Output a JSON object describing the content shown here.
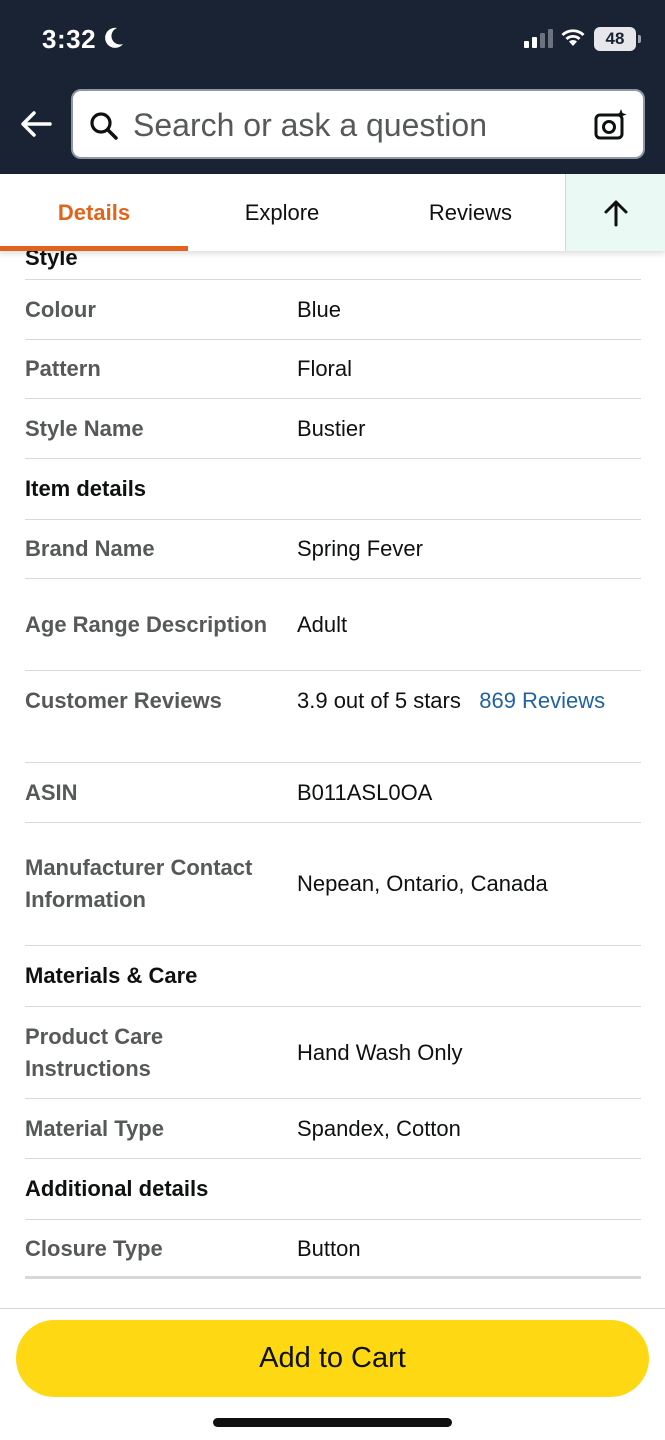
{
  "status_bar": {
    "time": "3:32",
    "battery": "48"
  },
  "search": {
    "placeholder": "Search or ask a question"
  },
  "tabs": [
    {
      "label": "Details",
      "active": true
    },
    {
      "label": "Explore",
      "active": false
    },
    {
      "label": "Reviews",
      "active": false
    }
  ],
  "sections": {
    "style": {
      "title": "Style",
      "rows": [
        {
          "label": "Colour",
          "value": "Blue"
        },
        {
          "label": "Pattern",
          "value": "Floral"
        },
        {
          "label": "Style Name",
          "value": "Bustier"
        }
      ]
    },
    "item_details": {
      "title": "Item details",
      "rows": [
        {
          "label": "Brand Name",
          "value": "Spring Fever"
        },
        {
          "label": "Age Range Description",
          "value": "Adult"
        },
        {
          "label": "Customer Reviews",
          "value": "3.9 out of 5 stars",
          "link": "869 Reviews"
        },
        {
          "label": "ASIN",
          "value": "B011ASL0OA"
        },
        {
          "label": "Manufacturer Contact Information",
          "value": "Nepean, Ontario, Canada"
        }
      ]
    },
    "materials": {
      "title": "Materials & Care",
      "rows": [
        {
          "label": "Product Care Instructions",
          "value": "Hand Wash Only"
        },
        {
          "label": "Material Type",
          "value": "Spandex, Cotton"
        }
      ]
    },
    "additional": {
      "title": "Additional details",
      "rows": [
        {
          "label": "Closure Type",
          "value": "Button"
        }
      ]
    }
  },
  "cart": {
    "button_label": "Add to Cart"
  },
  "colors": {
    "header_bg": "#1a2333",
    "accent": "#e0641b",
    "cart_button": "#ffd814",
    "link": "#2162a1"
  }
}
